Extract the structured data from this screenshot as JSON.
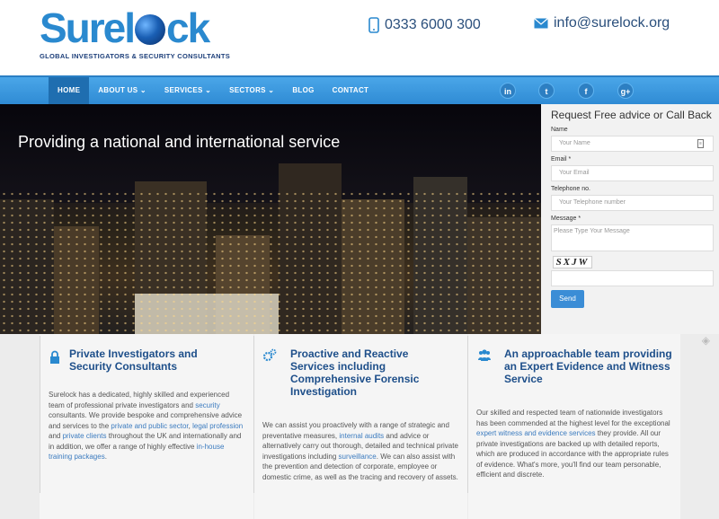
{
  "header": {
    "logo_word_left": "Surel",
    "logo_word_right": "ck",
    "logo_tagline": "GLOBAL INVESTIGATORS & SECURITY CONSULTANTS",
    "phone": "0333 6000 300",
    "email": "info@surelock.org"
  },
  "nav": {
    "items": [
      {
        "label": "HOME"
      },
      {
        "label": "ABOUT US ⌄"
      },
      {
        "label": "SERVICES ⌄"
      },
      {
        "label": "SECTORS ⌄"
      },
      {
        "label": "BLOG"
      },
      {
        "label": "CONTACT"
      }
    ],
    "social": [
      "in",
      "t",
      "f",
      "g+"
    ]
  },
  "hero": {
    "title": "Providing a national and international service"
  },
  "form": {
    "title": "Request Free advice or Call Back",
    "name_label": "Name",
    "name_placeholder": "Your Name",
    "email_label": "Email *",
    "email_placeholder": "Your Email",
    "phone_label": "Telephone no.",
    "phone_placeholder": "Your Telephone number",
    "message_label": "Message *",
    "message_placeholder": "Please Type Your Message",
    "captcha_text": "SXJW",
    "send_label": "Send"
  },
  "features": [
    {
      "title": "Private Investigators and Security Consultants",
      "text_html": "Surelock has a dedicated, highly skilled and experienced team of professional private investigators and <a>security</a> consultants. We provide bespoke and comprehensive advice and services to the <a>private and public sector</a>, <a>legal profession</a> and <a>private clients</a> throughout the UK and internationally and in addition, we offer a range of highly effective <a>in-house training packages</a>."
    },
    {
      "title": "Proactive and Reactive Services including Comprehensive Forensic Investigation",
      "text_html": "We can assist you proactively with a range of strategic and preventative measures, <a>internal audits</a> and advice or alternatively carry out thorough, detailed and technical private investigations including <a>surveillance</a>. We can also assist with the prevention and detection of corporate, employee or domestic crime, as well as the tracing and recovery of assets."
    },
    {
      "title": "An approachable team providing an Expert Evidence and Witness Service",
      "text_html": "Our skilled and respected team of nationwide investigators has been commended at the highest level for the exceptional <a>expert witness and evidence services</a> they provide. All our private investigations are backed up with detailed reports, which are produced in accordance with the appropriate rules of evidence. What's more, you'll find our team personable, efficient and discrete."
    }
  ],
  "colors": {
    "brand_blue": "#2a89cf",
    "nav_blue": "#3b97de",
    "title_navy": "#1e4f8a"
  }
}
